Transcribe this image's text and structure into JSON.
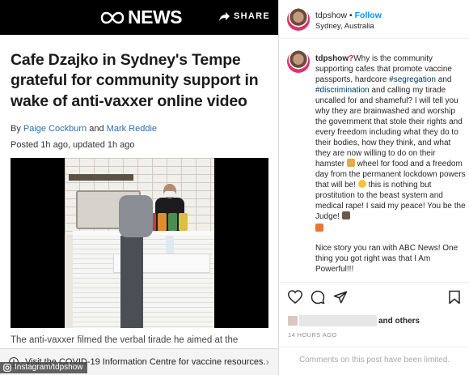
{
  "abc": {
    "logo_text": "NEWS",
    "share_label": "SHARE",
    "headline": "Cafe Dzajko in Sydney's Tempe grateful for community support in wake of anti-vaxxer online video",
    "byline_prefix": "By",
    "author1": "Paige Cockburn",
    "byline_and": "and",
    "author2": "Mark Reddie",
    "posted": "Posted 1h ago, updated 1h ago",
    "article_snippet": "The anti-vaxxer filmed the verbal tirade he aimed at the",
    "covid_banner": "Visit the COVID-19 Information Centre for vaccine resources.",
    "watermark": "Instagram/tdpshow"
  },
  "instagram": {
    "username": "tdpshow",
    "dot": "•",
    "follow_label": "Follow",
    "location": "Sydney, Australia",
    "comment": {
      "username": "tdpshow",
      "text_1": "Why is the community supporting cafes that promote vaccine passports, hardcore ",
      "hashtag_1": "#segregation",
      "text_2": " and ",
      "hashtag_2": "#discrimination",
      "text_3": " and calling my tirade uncalled for and shameful? I will tell you why they are brainwashed and worship the government that stole their rights and every freedom including what they do to their bodies, how they think, and what they are now willing to do on their hamster ",
      "text_4": " wheel for food and a freedom day from the permanent lockdown powers that will be! ",
      "text_5": " this is nothing but prostitution to the beast system and medical rape! I said my peace! You be the Judge! ",
      "para_2": "Nice story you ran with ABC News! One thing you got right was that I Am Powerful!!!",
      "age": "14 h"
    },
    "likes_suffix": "and others",
    "posted_ago": "14 HOURS AGO",
    "comments_limited": "Comments on this post have been limited."
  },
  "icons": [
    "abc-logo-icon",
    "share-arrow-icon",
    "info-icon",
    "chevron-right-icon",
    "instagram-glyph-icon",
    "heart-icon",
    "comment-icon",
    "send-icon",
    "bookmark-icon",
    "question-mark-emoji-icon",
    "hamster-emoji-icon",
    "grin-emoji-icon",
    "judge-emoji-icon",
    "collision-emoji-icon"
  ],
  "colors": {
    "abc_header": "#000000",
    "ig_link": "#0095f6",
    "hashtag": "#00376b",
    "author_link": "#2f6ead"
  }
}
